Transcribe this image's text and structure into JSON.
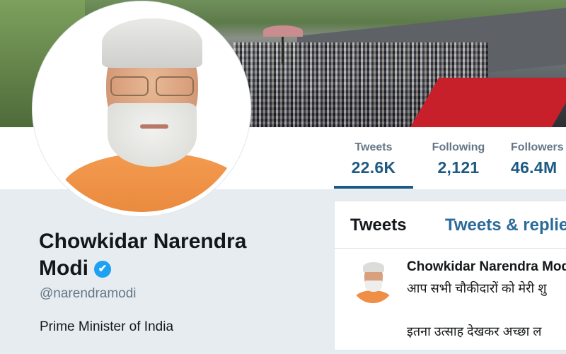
{
  "profile": {
    "name": "Chowkidar Narendra Modi",
    "verified_badge": "✔",
    "handle": "@narendramodi",
    "bio": "Prime Minister of India"
  },
  "stats": {
    "tweets_label": "Tweets",
    "tweets_value": "22.6K",
    "following_label": "Following",
    "following_value": "2,121",
    "followers_label": "Followers",
    "followers_value": "46.4M"
  },
  "timeline": {
    "tabs": [
      {
        "label": "Tweets"
      },
      {
        "label": "Tweets & replies"
      }
    ],
    "tweet": {
      "author": "Chowkidar Narendra Modi",
      "line1": "आप सभी चौकीदारों को मेरी शु",
      "line2": "इतना उत्साह देखकर अच्छा ल"
    }
  },
  "colors": {
    "accent": "#1c5a83",
    "tab_link": "#2b6b99",
    "verified": "#1da1f2",
    "muted": "#657786"
  }
}
